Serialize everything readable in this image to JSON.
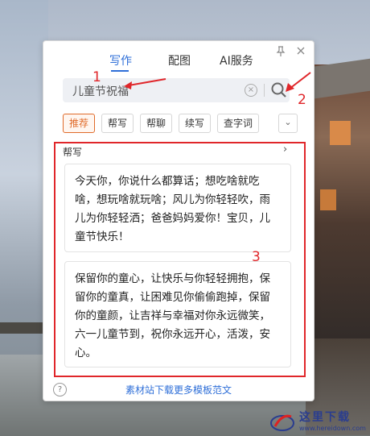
{
  "tabs": [
    {
      "label": "写作"
    },
    {
      "label": "配图"
    },
    {
      "label": "AI服务"
    }
  ],
  "search": {
    "value": "儿童节祝福"
  },
  "chips": [
    {
      "label": "推荐"
    },
    {
      "label": "帮写"
    },
    {
      "label": "帮聊"
    },
    {
      "label": "续写"
    },
    {
      "label": "查字词"
    }
  ],
  "section": {
    "title": "帮写"
  },
  "cards": [
    {
      "text": "今天你，你说什么都算话；想吃啥就吃啥，想玩啥就玩啥；风儿为你轻轻吹，雨儿为你轻轻洒；爸爸妈妈爱你！宝贝，儿童节快乐！"
    },
    {
      "text": "保留你的童心，让快乐与你轻轻拥抱，保留你的童真，让困难见你偷偷跑掉，保留你的童颜，让吉祥与幸福对你永远微笑，六一儿童节到，祝你永远开心，活泼，安心。"
    }
  ],
  "footer": {
    "link": "素材站下载更多模板范文"
  },
  "annotations": {
    "one": "1",
    "two": "2",
    "three": "3"
  },
  "watermark": {
    "text": "这里下载",
    "url": "www.hereidown.com"
  },
  "colors": {
    "accent": "#2f6fd8",
    "chip_active": "#e06b2a",
    "annotation": "#e0262a"
  }
}
